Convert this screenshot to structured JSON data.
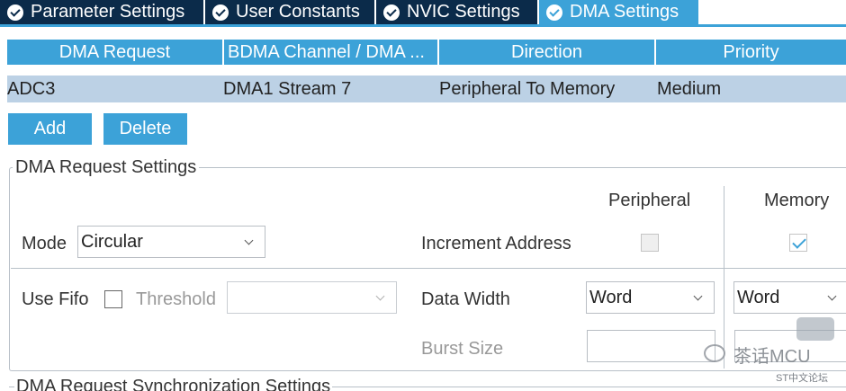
{
  "tabs": [
    {
      "label": "Parameter Settings"
    },
    {
      "label": "User Constants"
    },
    {
      "label": "NVIC Settings"
    },
    {
      "label": "DMA Settings",
      "active": true
    }
  ],
  "table": {
    "headers": [
      "DMA Request",
      "BDMA Channel / DMA ...",
      "Direction",
      "Priority"
    ],
    "rows": [
      [
        "ADC3",
        "DMA1 Stream 7",
        "Peripheral To Memory",
        "Medium"
      ]
    ]
  },
  "buttons": {
    "add": "Add",
    "delete": "Delete"
  },
  "settings": {
    "title": "DMA Request Settings",
    "col_peripheral": "Peripheral",
    "col_memory": "Memory",
    "mode_label": "Mode",
    "mode_value": "Circular",
    "increment_label": "Increment Address",
    "peripheral_increment": false,
    "memory_increment": true,
    "use_fifo_label": "Use Fifo",
    "use_fifo": false,
    "threshold_label": "Threshold",
    "threshold_value": "",
    "data_width_label": "Data Width",
    "peripheral_data_width": "Word",
    "memory_data_width": "Word",
    "burst_size_label": "Burst Size",
    "peripheral_burst_size": "",
    "memory_burst_size": ""
  },
  "sync_title": "DMA Request Synchronization Settings",
  "watermark": {
    "text": "茶话MCU",
    "sub": "ST中文论坛"
  },
  "colors": {
    "accent": "#3ca2d8",
    "tab_dark": "#0b2b4a",
    "row_selected": "#bcd1e5"
  }
}
